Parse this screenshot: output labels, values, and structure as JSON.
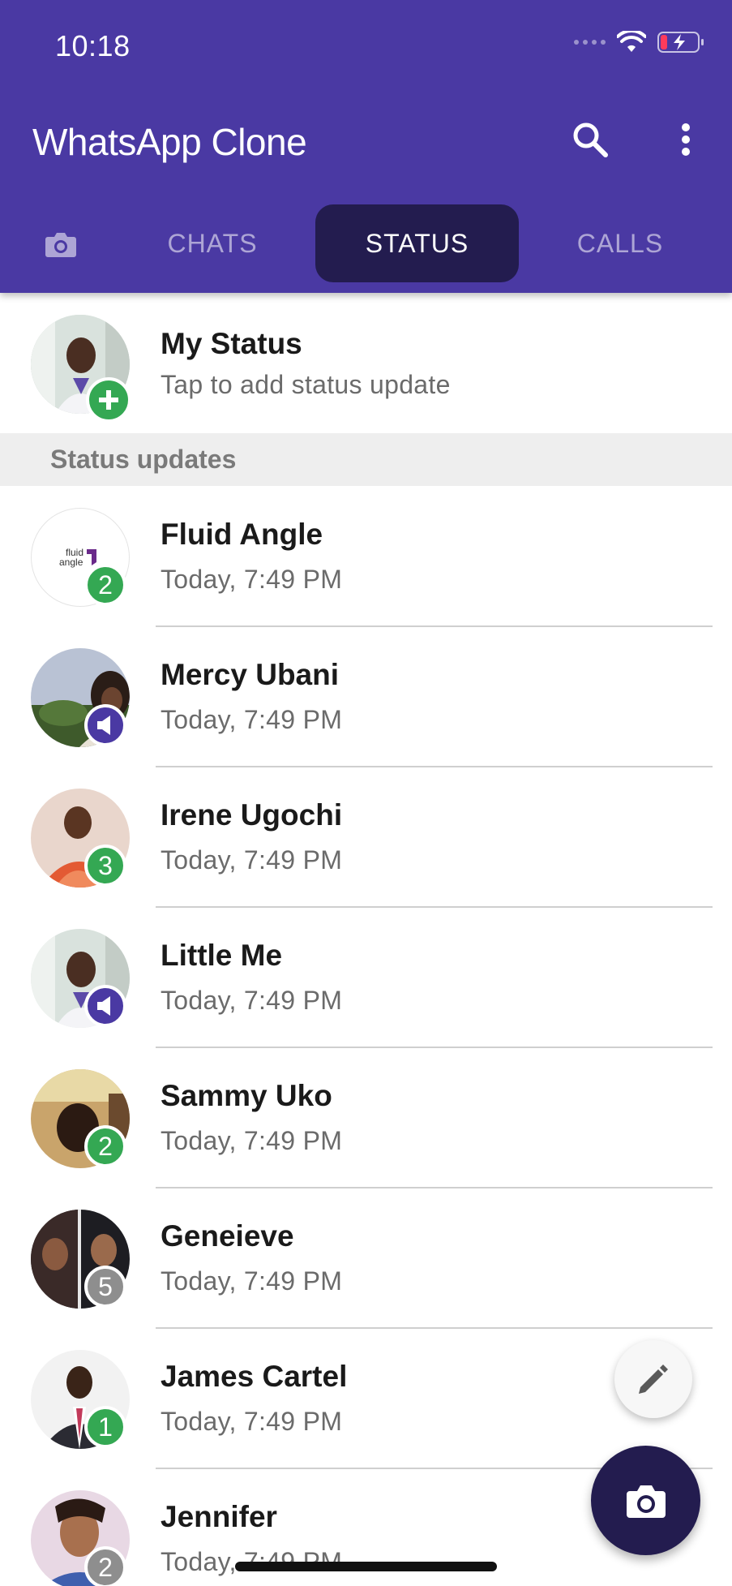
{
  "status_bar": {
    "time": "10:18"
  },
  "app_bar": {
    "title": "WhatsApp Clone"
  },
  "tabs": [
    {
      "label": "CHATS",
      "active": false
    },
    {
      "label": "STATUS",
      "active": true
    },
    {
      "label": "CALLS",
      "active": false
    }
  ],
  "my_status": {
    "name": "My Status",
    "subtitle": "Tap to add status update"
  },
  "section_header": "Status updates",
  "status_updates": [
    {
      "name": "Fluid Angle",
      "time": "Today, 7:49 PM",
      "badge": "2",
      "badge_type": "count-green",
      "avatar_logo": "fluid angle"
    },
    {
      "name": "Mercy Ubani",
      "time": "Today, 7:49 PM",
      "badge": "",
      "badge_type": "audio"
    },
    {
      "name": "Irene Ugochi",
      "time": "Today, 7:49 PM",
      "badge": "3",
      "badge_type": "count-green"
    },
    {
      "name": "Little Me",
      "time": "Today, 7:49 PM",
      "badge": "",
      "badge_type": "audio"
    },
    {
      "name": "Sammy Uko",
      "time": "Today, 7:49 PM",
      "badge": "2",
      "badge_type": "count-green"
    },
    {
      "name": "Geneieve",
      "time": "Today, 7:49 PM",
      "badge": "5",
      "badge_type": "count-gray"
    },
    {
      "name": "James Cartel",
      "time": "Today, 7:49 PM",
      "badge": "1",
      "badge_type": "count-green"
    },
    {
      "name": "Jennifer",
      "time": "Today, 7:49 PM",
      "badge": "2",
      "badge_type": "count-gray"
    }
  ],
  "colors": {
    "primary": "#4a39a3",
    "dark_accent": "#231c4f",
    "badge_green": "#34a853",
    "badge_gray": "#8e8e8e"
  },
  "icons": [
    "camera-icon",
    "search-icon",
    "more-vert-icon",
    "plus-icon",
    "speaker-icon",
    "pencil-icon",
    "wifi-icon",
    "battery-icon"
  ]
}
